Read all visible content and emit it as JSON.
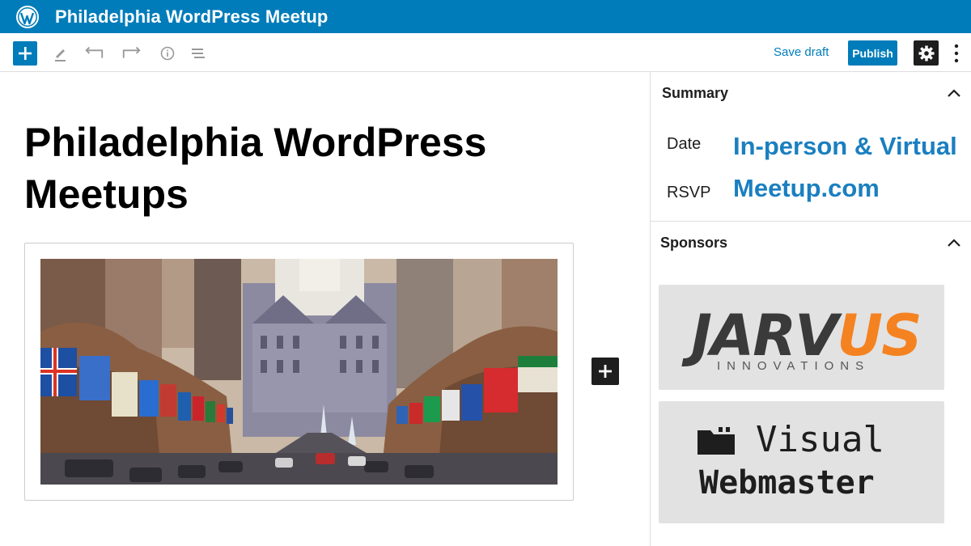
{
  "app": {
    "site_title": "Philadelphia WordPress Meetup"
  },
  "toolbar": {
    "add_icon": "plus-icon",
    "tools": [
      "pencil-icon",
      "undo-icon",
      "redo-icon",
      "info-icon",
      "list-view-icon"
    ],
    "save_draft_label": "Save draft",
    "publish_label": "Publish",
    "settings_icon": "gear-icon",
    "more_icon": "more-vertical-icon"
  },
  "editor": {
    "post_title": "Philadelphia WordPress Meetups",
    "image": "philadelphia-parkway-flags-city-hall",
    "inserter_icon": "plus-icon"
  },
  "sidebar": {
    "summary": {
      "title": "Summary",
      "rows": [
        {
          "label": "Date",
          "value": "In-person & Virtual"
        },
        {
          "label": "RSVP",
          "value": "Meetup.com"
        }
      ]
    },
    "sponsors": {
      "title": "Sponsors",
      "items": [
        {
          "name_a": "JARV",
          "name_b": "US",
          "subtitle": "INNOVATIONS",
          "color_a": "#3a3a3a",
          "color_b": "#f58220"
        },
        {
          "line1": "Visual",
          "line2": "Webmaster",
          "icon": "folder-icon"
        }
      ]
    }
  },
  "colors": {
    "brand": "#007cba",
    "link": "#1a7fc0",
    "dark": "#1e1e1e"
  }
}
